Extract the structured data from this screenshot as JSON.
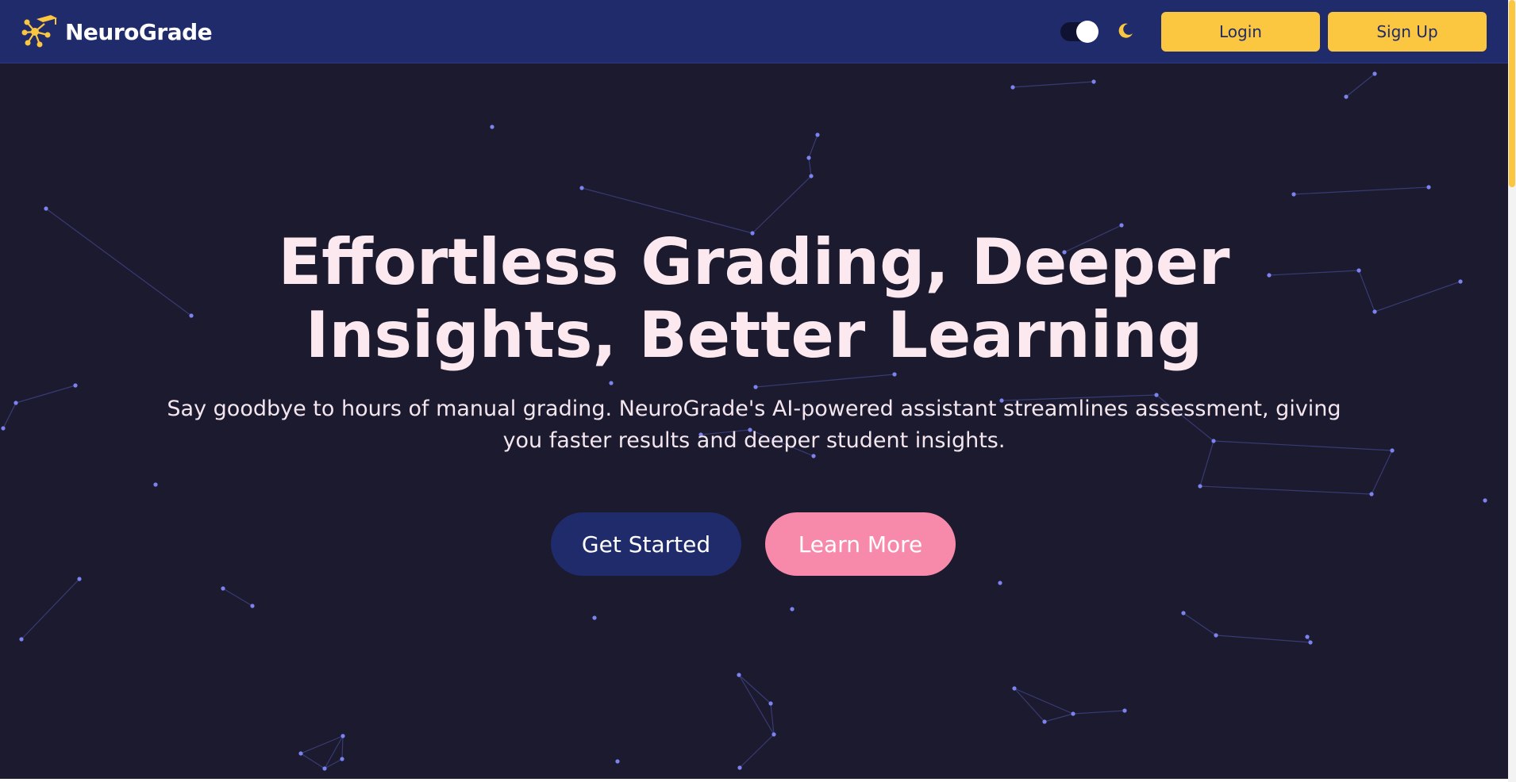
{
  "brand": {
    "name": "NeuroGrade",
    "logo_icon": "neural-graduation-cap-icon",
    "accent_color": "#fbc640",
    "navbar_color": "#1f2b6b"
  },
  "header": {
    "theme_toggle": {
      "state": "dark",
      "icon": "moon-icon"
    },
    "login_label": "Login",
    "signup_label": "Sign Up"
  },
  "hero": {
    "title_line_1": "Effortless Grading, Deeper",
    "title_line_2": "Insights, Better Learning",
    "subtitle_line_1": "Say goodbye to hours of manual grading. NeuroGrade's AI-powered assistant streamlines assessment, giving",
    "subtitle_line_2": "you faster results and deeper student insights.",
    "primary_cta": "Get Started",
    "secondary_cta": "Learn More",
    "background_color": "#1b1a2e",
    "title_color": "#fbe9ef",
    "secondary_cta_color": "#f78aaa"
  }
}
